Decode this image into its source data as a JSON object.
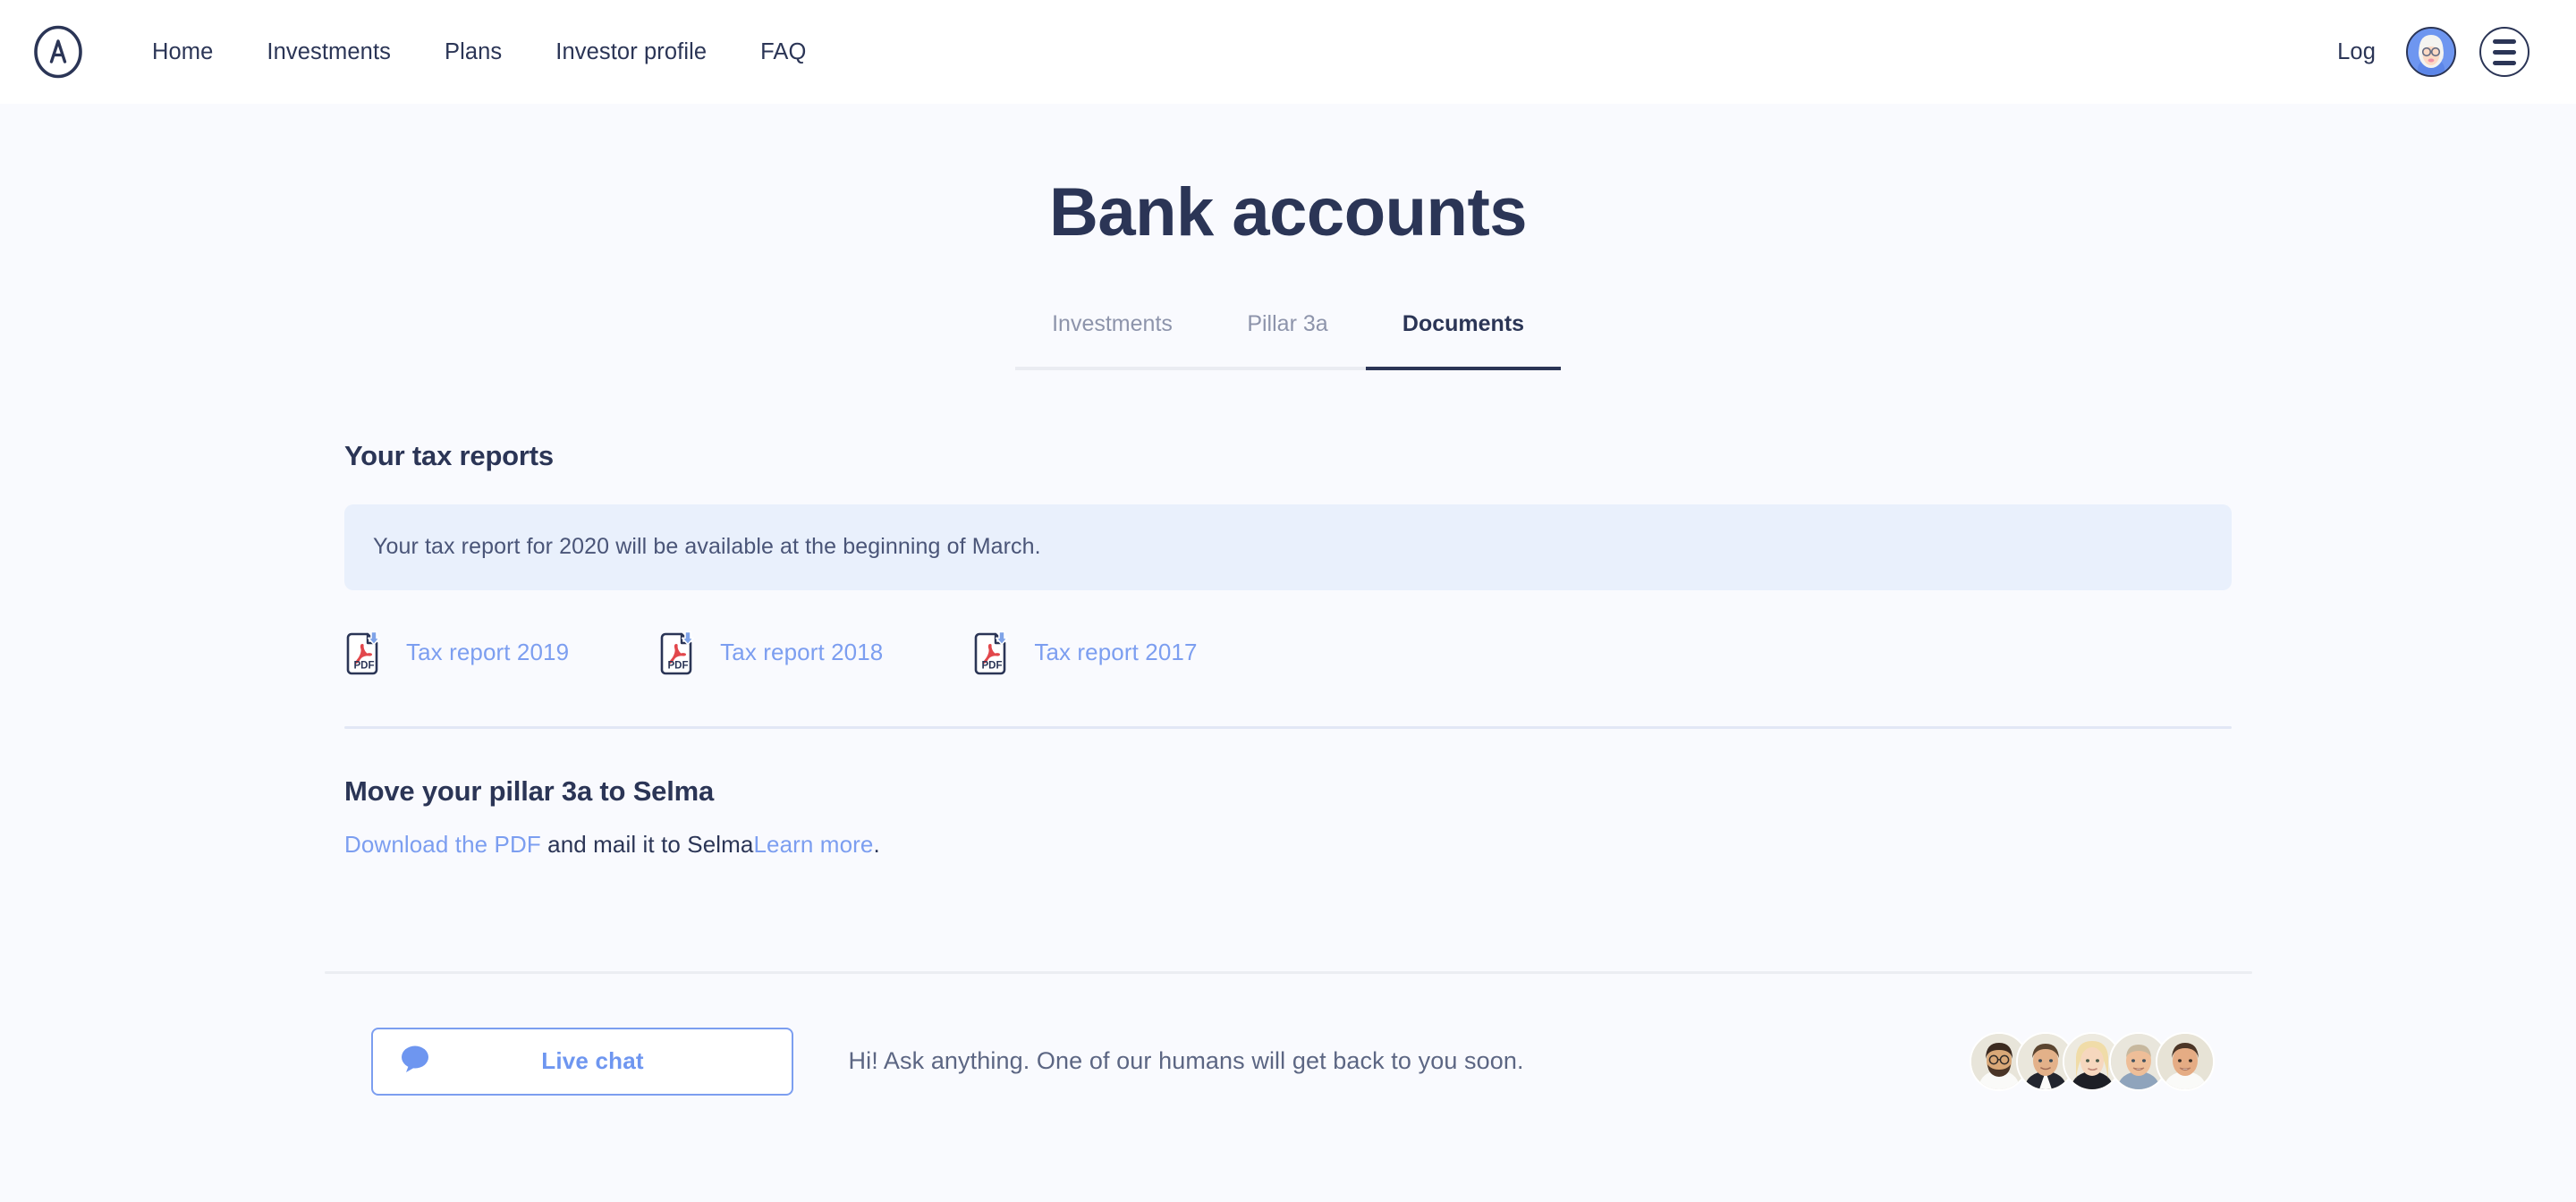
{
  "header": {
    "logo_letter": "A",
    "nav_items": [
      {
        "label": "Home"
      },
      {
        "label": "Investments"
      },
      {
        "label": "Plans"
      },
      {
        "label": "Investor profile"
      },
      {
        "label": "FAQ"
      }
    ],
    "log_label": "Log",
    "avatar_icon": "user-avatar-icon",
    "menu_icon": "hamburger-menu-icon"
  },
  "main": {
    "title": "Bank accounts",
    "tabs": [
      {
        "label": "Investments",
        "active": false
      },
      {
        "label": "Pillar 3a",
        "active": false
      },
      {
        "label": "Documents",
        "active": true
      }
    ],
    "tax_reports": {
      "heading": "Your tax reports",
      "notice": "Your tax report for 2020 will be available at the beginning of March.",
      "documents": [
        {
          "label": "Tax report 2019",
          "icon": "pdf-file-icon"
        },
        {
          "label": "Tax report 2018",
          "icon": "pdf-file-icon"
        },
        {
          "label": "Tax report 2017",
          "icon": "pdf-file-icon"
        }
      ]
    },
    "pillar": {
      "heading": "Move your pillar 3a to Selma",
      "link_download": "Download the PDF",
      "text_middle": " and mail it to Selma",
      "link_learn_more": "Learn more",
      "text_end": "."
    }
  },
  "footer": {
    "chat_button_label": "Live chat",
    "chat_icon": "speech-bubble-icon",
    "chat_message": "Hi! Ask anything. One of our humans will get back to you soon.",
    "team_avatars": [
      {
        "name": "team-member-1"
      },
      {
        "name": "team-member-2"
      },
      {
        "name": "team-member-3"
      },
      {
        "name": "team-member-4"
      },
      {
        "name": "team-member-5"
      }
    ]
  },
  "colors": {
    "navy": "#2B3556",
    "link_blue": "#7C9EF0",
    "accent_blue": "#6E96F0",
    "banner_bg": "#E9F0FC",
    "page_bg": "#F9FAFE",
    "muted_text": "#8D94AB"
  }
}
